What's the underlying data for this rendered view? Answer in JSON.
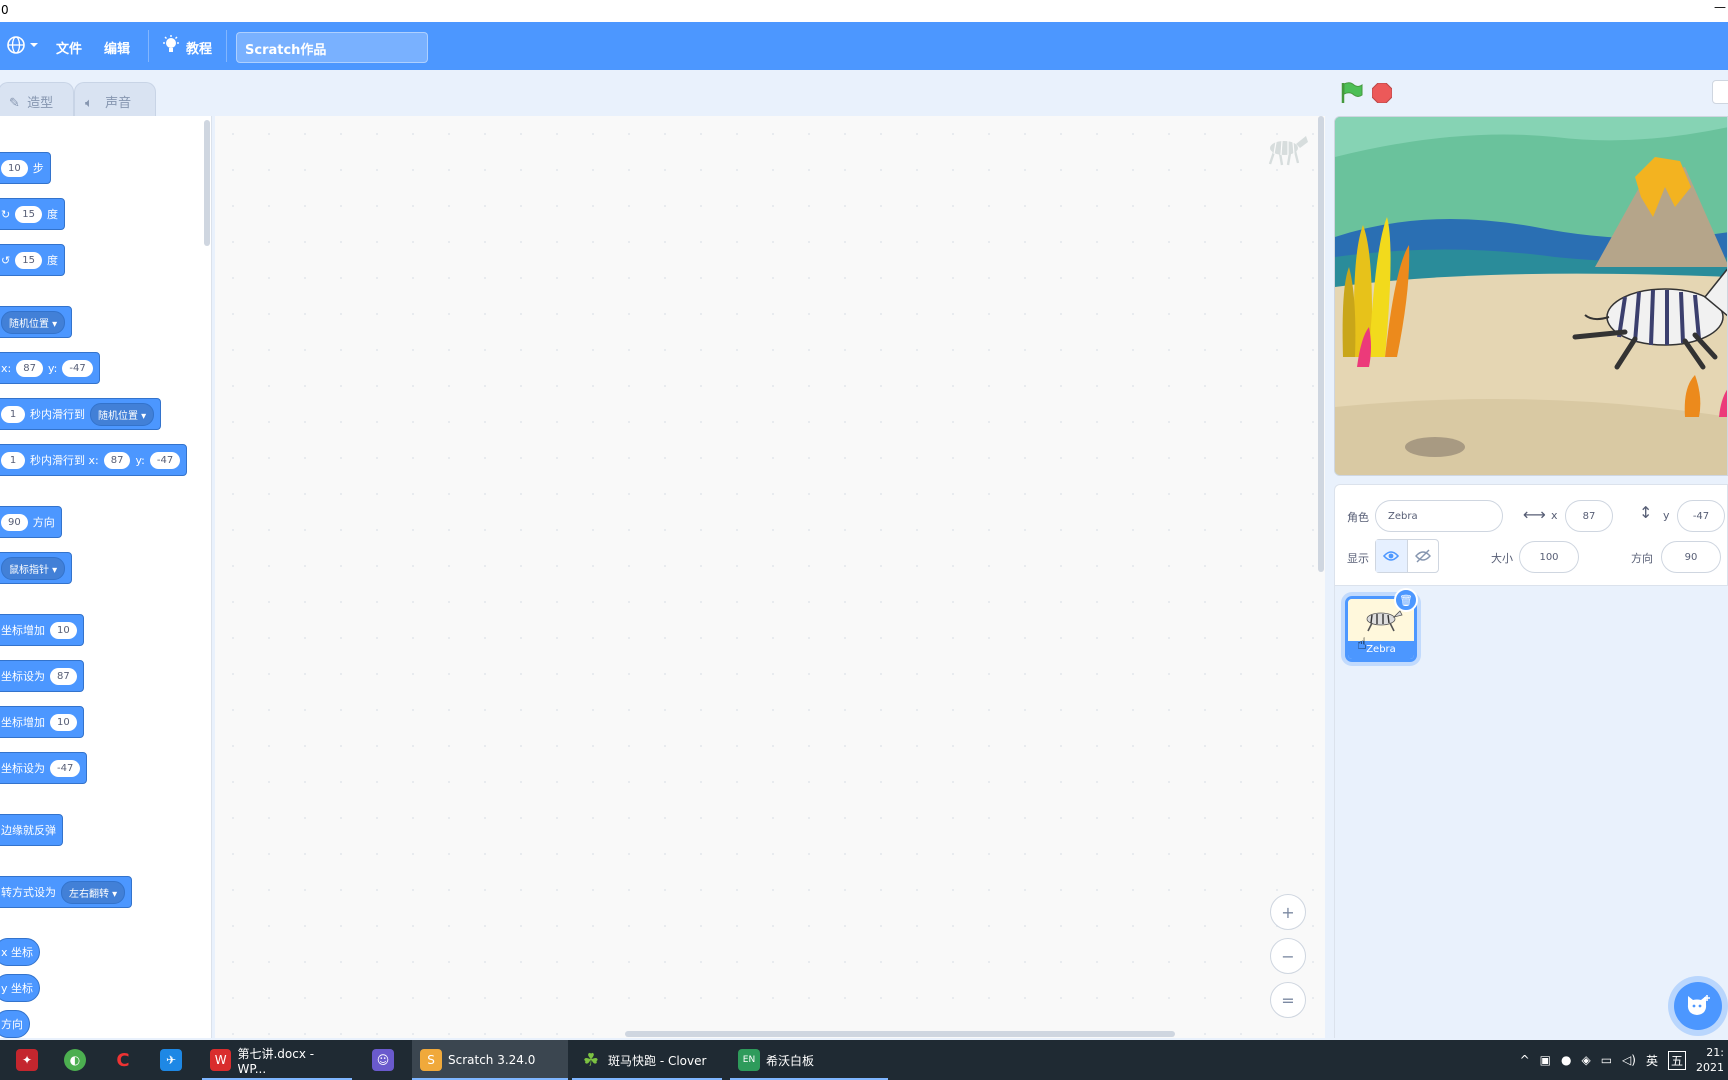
{
  "window": {
    "title": "0",
    "minimize": "—"
  },
  "menubar": {
    "file": "文件",
    "edit": "编辑",
    "tutorials": "教程",
    "project_title": "Scratch作品"
  },
  "tabs": [
    {
      "label": "造型"
    },
    {
      "label": "声音"
    }
  ],
  "palette": {
    "move_steps": {
      "value": "10",
      "label": "步"
    },
    "turn_right": {
      "value": "15",
      "label": "度"
    },
    "turn_left": {
      "value": "15",
      "label": "度"
    },
    "goto_random": {
      "dropdown": "随机位置"
    },
    "goto_xy": {
      "x_label": "x:",
      "x": "87",
      "y_label": "y:",
      "y": "-47"
    },
    "glide_random": {
      "secs": "1",
      "label": "秒内滑行到",
      "dropdown": "随机位置"
    },
    "glide_xy": {
      "secs": "1",
      "label": "秒内滑行到 x:",
      "x": "87",
      "y_label": "y:",
      "y": "-47"
    },
    "point_direction": {
      "value": "90",
      "label": "方向"
    },
    "point_towards": {
      "dropdown": "鼠标指针"
    },
    "change_x": {
      "label": "坐标增加",
      "value": "10"
    },
    "set_x": {
      "label": "坐标设为",
      "value": "87"
    },
    "change_y": {
      "label": "坐标增加",
      "value": "10"
    },
    "set_y": {
      "label": "坐标设为",
      "value": "-47"
    },
    "bounce": {
      "label": "边缘就反弹"
    },
    "rotation_style": {
      "label": "转方式设为",
      "dropdown": "左右翻转"
    },
    "x_position": "x 坐标",
    "y_position": "y 坐标",
    "direction": "方向"
  },
  "zoom": {
    "in": "+",
    "out": "−",
    "reset": "="
  },
  "sprite_info": {
    "sprite_label": "角色",
    "sprite_name": "Zebra",
    "x_label": "x",
    "x": "87",
    "y_label": "y",
    "y": "-47",
    "show_label": "显示",
    "size_label": "大小",
    "size": "100",
    "direction_label": "方向",
    "direction": "90"
  },
  "sprites": [
    {
      "name": "Zebra",
      "selected": true
    }
  ],
  "taskbar": {
    "items": [
      {
        "label": "第七讲.docx - WP..."
      },
      {
        "label": "Scratch 3.24.0"
      },
      {
        "label": "斑马快跑 - Clover"
      },
      {
        "label": "希沃白板"
      }
    ],
    "ime": "英",
    "ime2": "五",
    "clock_time": "21:",
    "clock_date": "2021"
  },
  "colors": {
    "accent": "#4c97ff",
    "taskbar": "#1f2a33"
  }
}
